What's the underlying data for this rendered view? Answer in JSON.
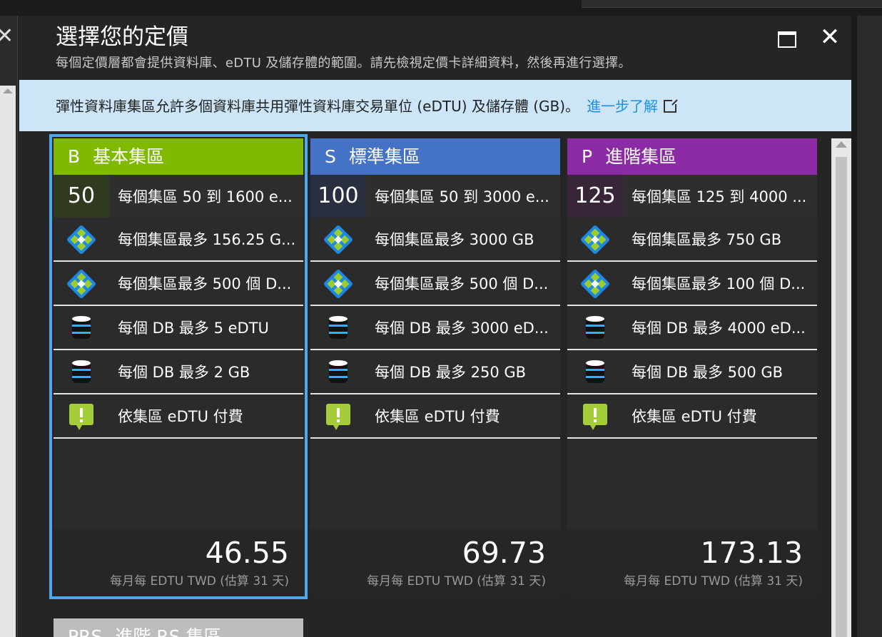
{
  "blade": {
    "title": "選擇您的定價",
    "subtitle": "每個定價層都會提供資料庫、eDTU 及儲存體的範圍。請先檢視定價卡詳細資料，然後再進行選擇。",
    "maximize_icon": "maximize-icon",
    "close_icon": "close-icon",
    "close_glyph": "✕"
  },
  "left_panel": {
    "close_glyph": "✕"
  },
  "banner": {
    "text": "彈性資料庫集區允許多個資料庫共用彈性資料庫交易單位 (eDTU) 及儲存體 (GB)。",
    "link": "進一步了解",
    "link_icon": "external-link-icon"
  },
  "colors": {
    "basic": "#7fba00",
    "standard": "#4472c4",
    "premium": "#8c2ba6",
    "prs": "#bdbdbd",
    "selected_outline": "#4aa9f0"
  },
  "cards": [
    {
      "tier": "B",
      "name": "基本集區",
      "num": "50",
      "rows": [
        "每個集區 50 到 1600 e...",
        "每個集區最多 156.25 G...",
        "每個集區最多 500 個 D...",
        "每個 DB 最多 5 eDTU",
        "每個 DB 最多 2 GB",
        "依集區 eDTU 付費"
      ],
      "price": "46.55",
      "unit": "每月每 EDTU TWD (估算 31 天)"
    },
    {
      "tier": "S",
      "name": "標準集區",
      "num": "100",
      "rows": [
        "每個集區 50 到 3000 e...",
        "每個集區最多 3000 GB",
        "每個集區最多 500 個 D...",
        "每個 DB 最多 3000 eD...",
        "每個 DB 最多 250 GB",
        "依集區 eDTU 付費"
      ],
      "price": "69.73",
      "unit": "每月每 EDTU TWD (估算 31 天)"
    },
    {
      "tier": "P",
      "name": "進階集區",
      "num": "125",
      "rows": [
        "每個集區 125 到 4000 ...",
        "每個集區最多 750 GB",
        "每個集區最多 100 個 D...",
        "每個 DB 最多 4000 eD...",
        "每個 DB 最多 500 GB",
        "依集區 eDTU 付費"
      ],
      "price": "173.13",
      "unit": "每月每 EDTU TWD (估算 31 天)"
    }
  ],
  "prs_card": {
    "tier": "PRS",
    "name": "進階 RS 集區"
  },
  "row_icons": [
    "pool-icon",
    "pool-icon",
    "database-icon",
    "database-icon",
    "alert-icon"
  ]
}
